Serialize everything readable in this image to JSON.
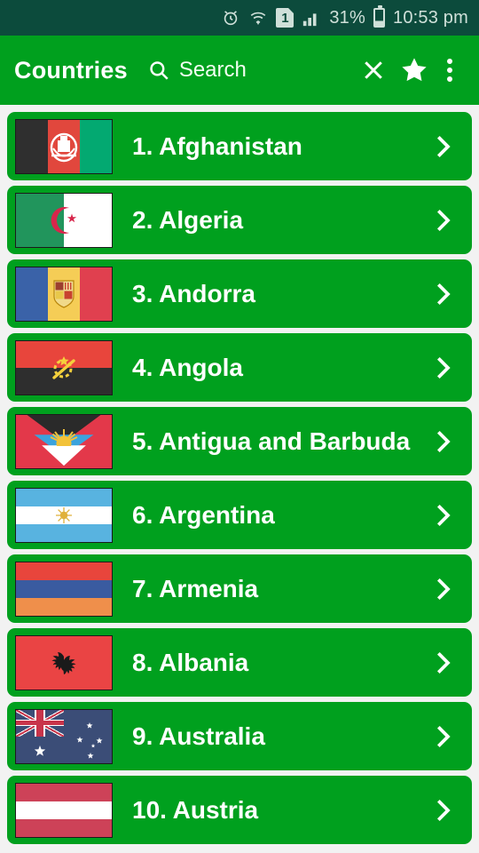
{
  "statusbar": {
    "alarm_icon": "alarm-clock-icon",
    "wifi_icon": "wifi-icon",
    "sim_label": "1",
    "signal_icon": "signal-bars-icon",
    "battery_percent": "31%",
    "battery_icon": "battery-icon",
    "clock": "10:53 pm"
  },
  "appbar": {
    "title": "Countries",
    "search_icon": "search-icon",
    "search_placeholder": "Search",
    "close_icon": "close-icon",
    "favorite_icon": "star-icon",
    "overflow_icon": "more-vertical-icon",
    "accent_color": "#00a01e"
  },
  "list": {
    "chevron_icon": "chevron-right-icon",
    "items": [
      {
        "label": "1. Afghanistan",
        "flag": "afghanistan"
      },
      {
        "label": "2. Algeria",
        "flag": "algeria"
      },
      {
        "label": "3. Andorra",
        "flag": "andorra"
      },
      {
        "label": "4. Angola",
        "flag": "angola"
      },
      {
        "label": "5. Antigua and Barbuda",
        "flag": "antigua"
      },
      {
        "label": "6. Argentina",
        "flag": "argentina"
      },
      {
        "label": "7. Armenia",
        "flag": "armenia"
      },
      {
        "label": "8. Albania",
        "flag": "albania"
      },
      {
        "label": "9. Australia",
        "flag": "australia"
      },
      {
        "label": "10. Austria",
        "flag": "austria"
      }
    ]
  }
}
